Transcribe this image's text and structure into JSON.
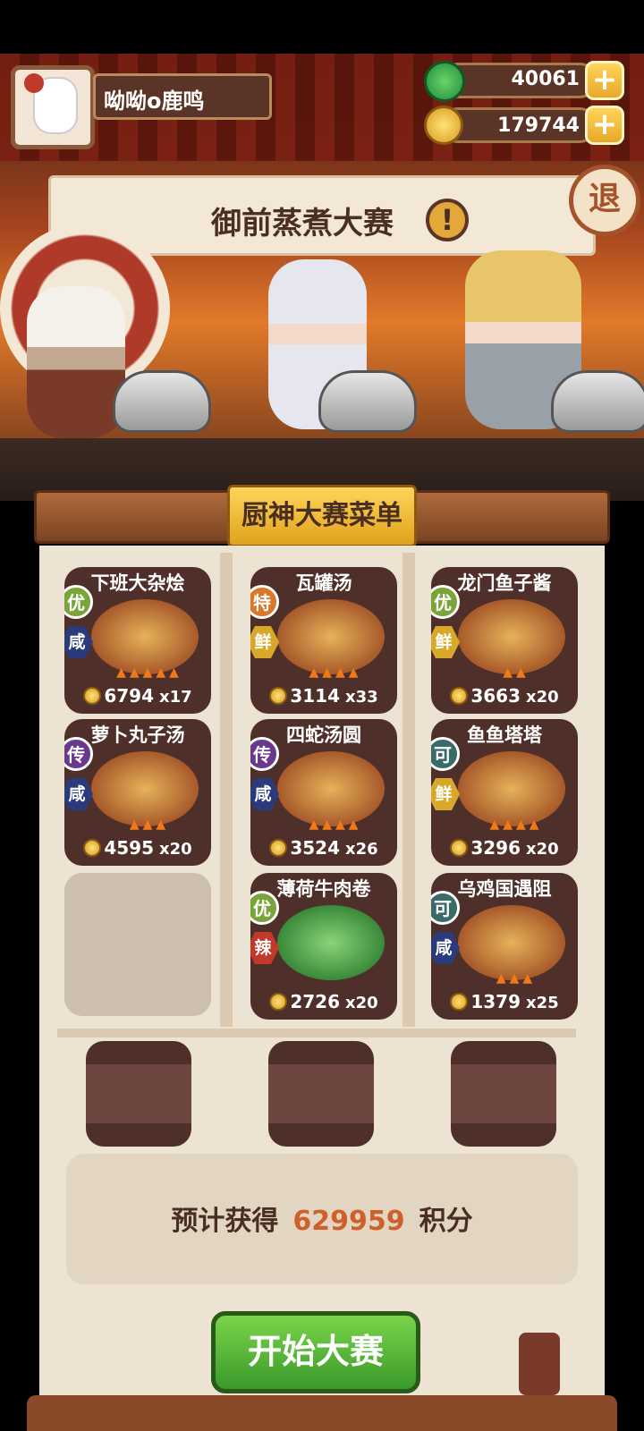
{
  "player": {
    "name": "呦呦o鹿鸣"
  },
  "currencies": {
    "jade": "40061",
    "coins": "179744"
  },
  "event": {
    "title": "御前蒸煮大赛",
    "exit_label": "退"
  },
  "menu": {
    "title": "厨神大赛菜单",
    "dishes": [
      {
        "name": "下班大杂烩",
        "grade": "优",
        "flavor": "咸",
        "price": "6794",
        "mult": "x17"
      },
      {
        "name": "瓦罐汤",
        "grade": "特",
        "flavor": "鲜",
        "price": "3114",
        "mult": "x33"
      },
      {
        "name": "龙门鱼子酱",
        "grade": "优",
        "flavor": "鲜",
        "price": "3663",
        "mult": "x20"
      },
      {
        "name": "萝卜丸子汤",
        "grade": "传",
        "flavor": "咸",
        "price": "4595",
        "mult": "x20"
      },
      {
        "name": "四蛇汤圆",
        "grade": "传",
        "flavor": "咸",
        "price": "3524",
        "mult": "x26"
      },
      {
        "name": "鱼鱼塔塔",
        "grade": "可",
        "flavor": "鲜",
        "price": "3296",
        "mult": "x20"
      },
      {
        "name": "薄荷牛肉卷",
        "grade": "优",
        "flavor": "辣",
        "price": "2726",
        "mult": "x20"
      },
      {
        "name": "乌鸡国遇阻",
        "grade": "可",
        "flavor": "咸",
        "price": "1379",
        "mult": "x25"
      }
    ]
  },
  "estimate": {
    "prefix": "预计获得",
    "value": "629959",
    "suffix": "积分"
  },
  "start_label": "开始大赛",
  "colors": {
    "grade_you": "#7aa43a",
    "grade_te": "#d9772a",
    "grade_chuan": "#6a3a8a",
    "grade_ke": "#3a6a6a",
    "flavor_xian": "#2a3a7a",
    "flavor_xian2": "#d8a82a",
    "flavor_la": "#c0392b"
  }
}
